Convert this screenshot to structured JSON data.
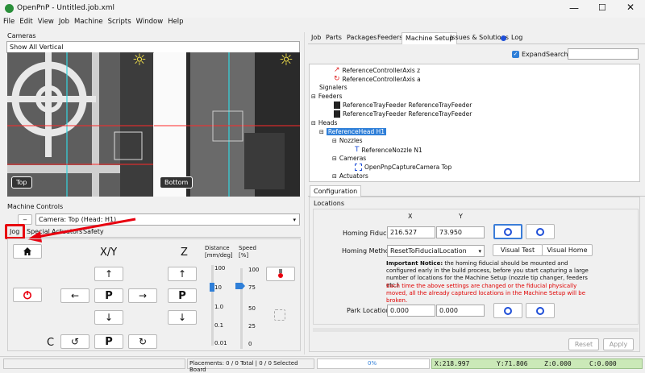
{
  "window": {
    "title": "OpenPnP - Untitled.job.xml"
  },
  "menu": [
    "File",
    "Edit",
    "View",
    "Job",
    "Machine",
    "Scripts",
    "Window",
    "Help"
  ],
  "cameras": {
    "label": "Cameras",
    "select_value": "Show All Vertical",
    "top_label": "Top",
    "bottom_label": "Bottom"
  },
  "machine_controls": {
    "label": "Machine Controls",
    "camera_select": "Camera: Top (Head: H1)",
    "tabs": [
      "Jog",
      "Special",
      "Actuators",
      "Safety"
    ],
    "xy_label": "X/Y",
    "z_label": "Z",
    "c_label": "C",
    "distance_label": "Distance [mm/deg]",
    "speed_label": "Speed [%]",
    "distance_ticks": [
      "100",
      "10",
      "1.0",
      "0.1",
      "0.01"
    ],
    "speed_ticks": [
      "100",
      "75",
      "50",
      "25",
      "0"
    ],
    "distance_value": "10",
    "speed_value_pct": 75,
    "park_label": "P"
  },
  "right_tabs": [
    "Job",
    "Parts",
    "Packages",
    "Feeders",
    "Machine Setup",
    "Issues & Solutions",
    "Log"
  ],
  "tree_toolbar": {
    "expand_label": "Expand",
    "search_label": "Search",
    "search_value": ""
  },
  "tree": [
    {
      "label": "ReferenceControllerAxis z"
    },
    {
      "label": "ReferenceControllerAxis a"
    },
    {
      "label": "Signalers"
    },
    {
      "label": "Feeders"
    },
    {
      "label": "ReferenceTrayFeeder ReferenceTrayFeeder"
    },
    {
      "label": "ReferenceTrayFeeder ReferenceTrayFeeder"
    },
    {
      "label": "Heads"
    },
    {
      "label": "ReferenceHead H1"
    },
    {
      "label": "Nozzles"
    },
    {
      "label": "ReferenceNozzle N1"
    },
    {
      "label": "Cameras"
    },
    {
      "label": "OpenPnpCaptureCamera Top"
    },
    {
      "label": "Actuators"
    }
  ],
  "config": {
    "tab": "Configuration",
    "section": "Locations",
    "x_header": "X",
    "y_header": "Y",
    "homing_fiducial_label": "Homing Fiducial",
    "homing_x": "216.527",
    "homing_y": "73.950",
    "homing_method_label": "Homing Method",
    "homing_method_value": "ResetToFiducialLocation",
    "visual_test": "Visual Test",
    "visual_home": "Visual Home",
    "notice_bold": "Important Notice:",
    "notice_text": " the homing fiducial should be mounted and configured early in the build process, before you start capturing a large number of locations for the Machine Setup (nozzle tip changer, feeders etc.)",
    "warning_text": "Each time the above settings are changed or the fiducial physically moved, all the already captured locations in the Machine Setup will be broken.",
    "park_label": "Park Location",
    "park_x": "0.000",
    "park_y": "0.000",
    "reset": "Reset",
    "apply": "Apply"
  },
  "status": {
    "placements": "Placements: 0 / 0 Total | 0 / 0 Selected Board",
    "progress_pct": 0,
    "progress_text": "0%",
    "dro_x": "X:218.997",
    "dro_y": "Y:71.806",
    "dro_z": "Z:0.000",
    "dro_c": "C:0.000"
  },
  "colors": {
    "titlebar": "#f3f3f3",
    "accent_red": "#e8000f",
    "select_blue": "#2f7fd8",
    "dro_bg": "#cbe9b8",
    "warning": "#e00000"
  }
}
